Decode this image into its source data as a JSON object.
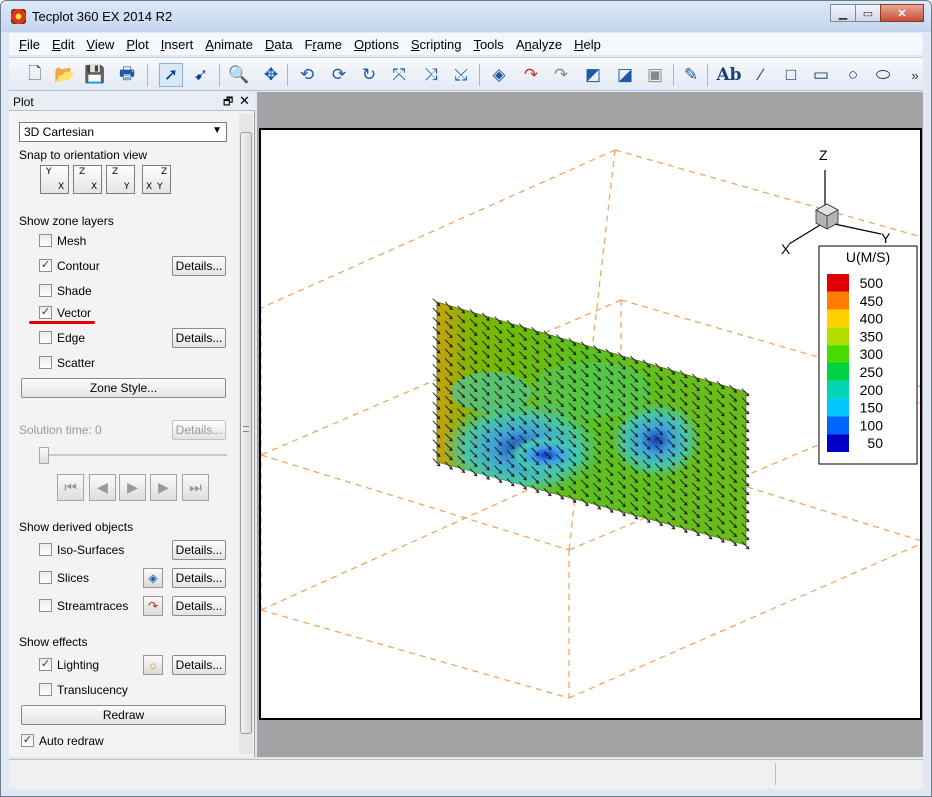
{
  "window": {
    "title": "Tecplot 360 EX 2014 R2"
  },
  "menu": [
    "File",
    "Edit",
    "View",
    "Plot",
    "Insert",
    "Animate",
    "Data",
    "Frame",
    "Options",
    "Scripting",
    "Tools",
    "Analyze",
    "Help"
  ],
  "menu_underline": [
    "F",
    "E",
    "V",
    "P",
    "I",
    "A",
    "D",
    "r",
    "O",
    "S",
    "T",
    "n",
    "H"
  ],
  "panel": {
    "title": "Plot",
    "plot_type": "3D Cartesian",
    "snap_label": "Snap to orientation view",
    "views": [
      {
        "top": "Y",
        "bottom": "X"
      },
      {
        "top": "Z",
        "bottom": "X"
      },
      {
        "top": "Z",
        "bottom": "Y"
      },
      {
        "top": "Z",
        "bottom": "XY"
      }
    ],
    "zone_layers_label": "Show zone layers",
    "layers": [
      {
        "label": "Mesh",
        "checked": false
      },
      {
        "label": "Contour",
        "checked": true,
        "details": "Details..."
      },
      {
        "label": "Shade",
        "checked": false
      },
      {
        "label": "Vector",
        "checked": true
      },
      {
        "label": "Edge",
        "checked": false,
        "details": "Details..."
      },
      {
        "label": "Scatter",
        "checked": false
      }
    ],
    "zone_style": "Zone Style...",
    "solution_time": "Solution time:  0",
    "solution_details": "Details...",
    "derived_label": "Show derived objects",
    "derived": [
      {
        "label": "Iso-Surfaces",
        "checked": false,
        "details": "Details..."
      },
      {
        "label": "Slices",
        "checked": false,
        "details": "Details..."
      },
      {
        "label": "Streamtraces",
        "checked": false,
        "details": "Details..."
      }
    ],
    "effects_label": "Show effects",
    "effects": [
      {
        "label": "Lighting",
        "checked": true,
        "details": "Details..."
      },
      {
        "label": "Translucency",
        "checked": false
      }
    ],
    "redraw": "Redraw",
    "auto_redraw": {
      "label": "Auto redraw",
      "checked": true
    }
  },
  "plot": {
    "axes": {
      "z": "Z",
      "x": "X",
      "y": "Y"
    },
    "legend": {
      "title": "U(M/S)",
      "levels": [
        "500",
        "450",
        "400",
        "350",
        "300",
        "250",
        "200",
        "150",
        "100",
        "50"
      ],
      "colors": [
        "#e00000",
        "#ff7d00",
        "#ffd200",
        "#b4dc00",
        "#46dc00",
        "#00d246",
        "#00d6b4",
        "#00c8ff",
        "#0064ff",
        "#0000c8"
      ]
    }
  }
}
